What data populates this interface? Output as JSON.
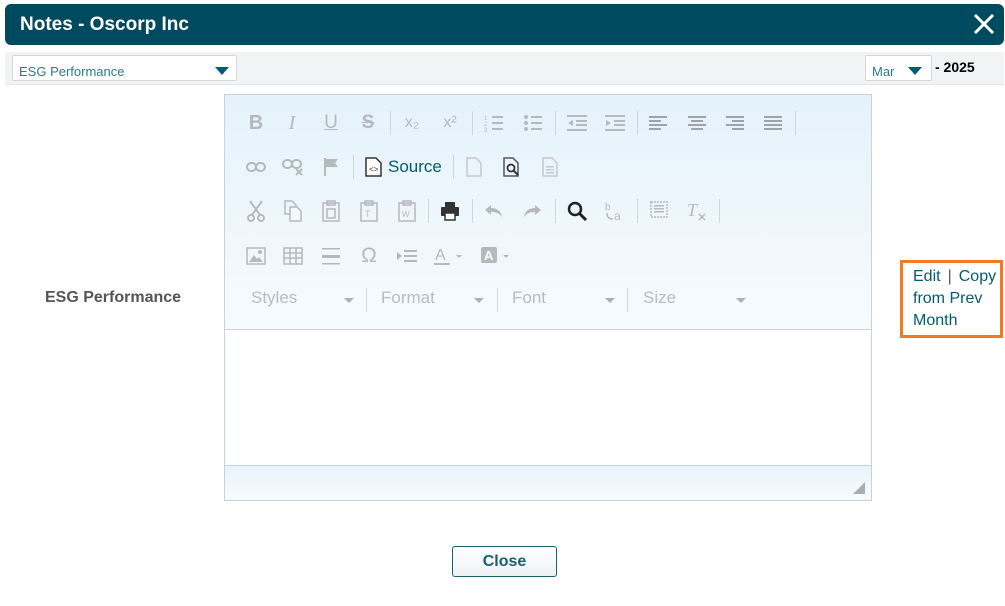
{
  "dialog": {
    "title": "Notes - Oscorp Inc"
  },
  "filters": {
    "metric": "ESG Performance",
    "month": "Mar",
    "year": "- 2025"
  },
  "form": {
    "row_label": "ESG Performance"
  },
  "editor": {
    "source_label": "Source",
    "styles_label": "Styles",
    "format_label": "Format",
    "font_label": "Font",
    "size_label": "Size",
    "content": ""
  },
  "actions": {
    "edit": "Edit",
    "separator": "|",
    "copy": "Copy from Prev Month"
  },
  "footer": {
    "close_label": "Close"
  },
  "colors": {
    "header_bg": "#004a5f",
    "accent": "#005d6b",
    "highlight": "#f47a20"
  }
}
